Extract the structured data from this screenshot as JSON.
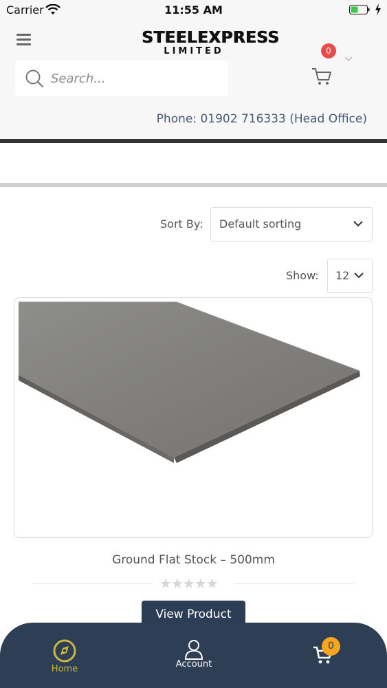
{
  "status_bar": {
    "carrier": "Carrier",
    "time": "11:55 AM"
  },
  "header": {
    "logo_main": "STEELEXPRESS",
    "logo_sub": "LIMITED",
    "search_placeholder": "Search...",
    "cart_count": "0",
    "phone": "Phone: 01902 716333 (Head Office)"
  },
  "shop": {
    "sort_label": "Sort By:",
    "sort_value": "Default sorting",
    "show_label": "Show:",
    "show_value": "12"
  },
  "product": {
    "title": "Ground Flat Stock – 500mm",
    "rating_stars": "★★★★★",
    "button": "View Product"
  },
  "tabbar": {
    "home": "Home",
    "account": "Account",
    "cart_count": "0"
  },
  "colors": {
    "accent_dark": "#2d3e55",
    "cart_badge": "#e94b4b",
    "tab_badge": "#f5a51e",
    "home_active": "#c9b640"
  }
}
